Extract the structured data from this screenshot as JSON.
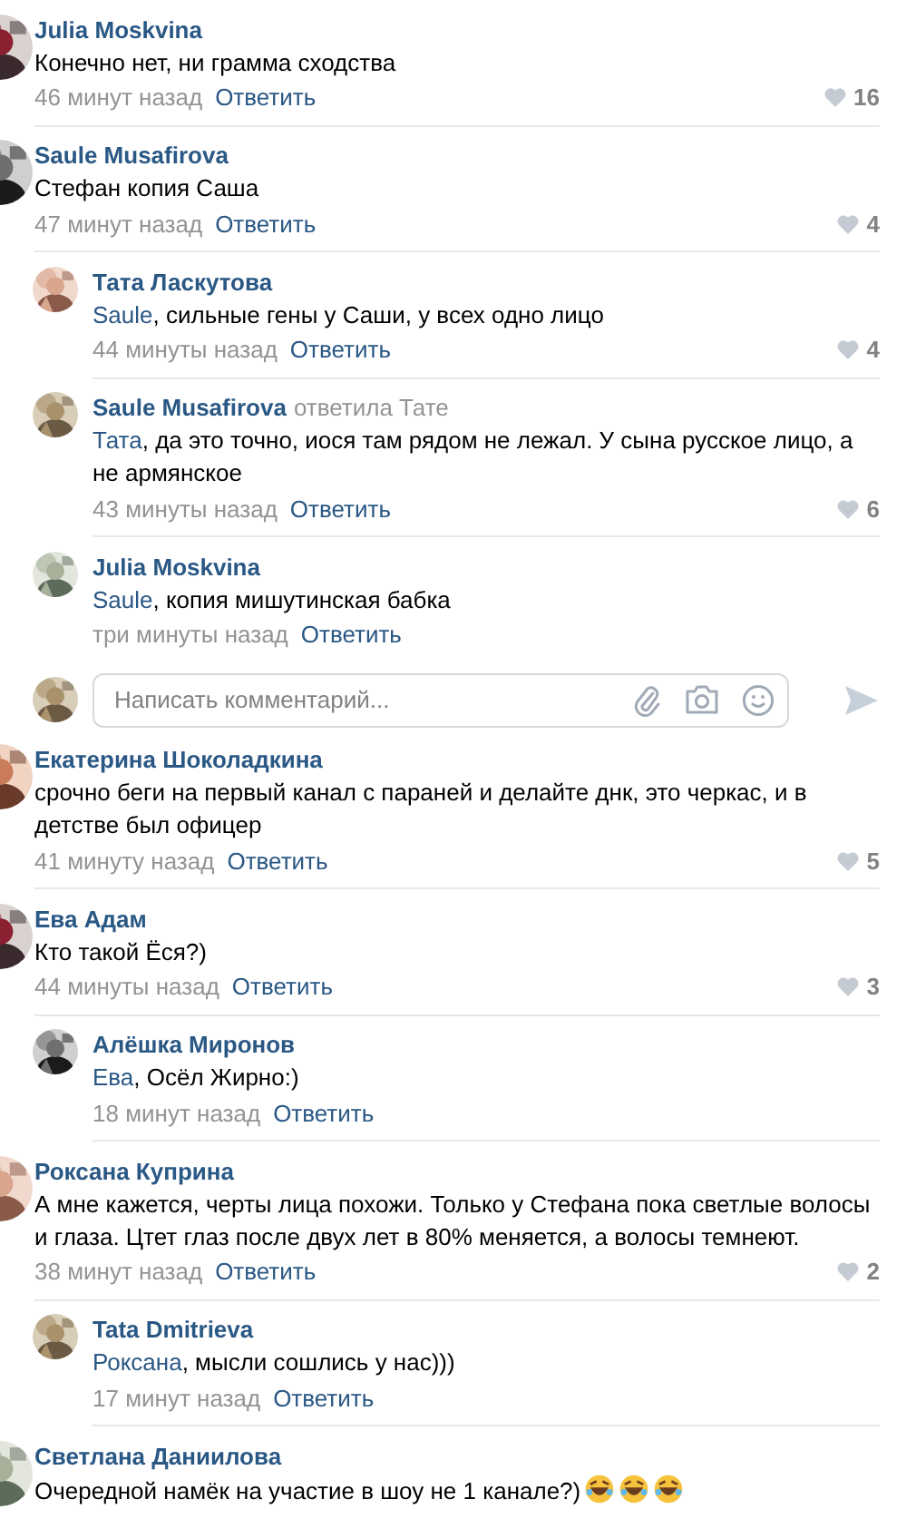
{
  "comments": [
    {
      "author": "Julia Moskvina",
      "text": "Конечно нет, ни грамма сходства",
      "time": "46 минут назад",
      "reply_label": "Ответить",
      "likes": "16"
    },
    {
      "author": "Saule Musafirova",
      "text": "Стефан копия Саша",
      "time": "47 минут назад",
      "reply_label": "Ответить",
      "likes": "4",
      "children": [
        {
          "author": "Тата Ласкутова",
          "mention": "Saule",
          "text": ", сильные гены у Саши, у всех одно лицо",
          "time": "44 минуты назад",
          "reply_label": "Ответить",
          "likes": "4"
        },
        {
          "author": "Saule Musafirova",
          "replied_to": "ответила Тате",
          "mention": "Тата",
          "text": ", да это точно, иося там рядом не лежал. У сына русское лицо, а не армянское",
          "time": "43 минуты назад",
          "reply_label": "Ответить",
          "likes": "6"
        },
        {
          "author": "Julia Moskvina",
          "mention": "Saule",
          "text": ", копия мишутинская бабка",
          "time": "три минуты назад",
          "reply_label": "Ответить"
        }
      ],
      "reply_form": {
        "placeholder": "Написать комментарий..."
      }
    },
    {
      "author": "Екатерина Шоколадкина",
      "text": "срочно беги на первый канал с параней и делайте днк, это черкас, и в детстве был офицер",
      "time": "41 минуту назад",
      "reply_label": "Ответить",
      "likes": "5"
    },
    {
      "author": "Ева Адам",
      "text": "Кто такой Ёся?)",
      "time": "44 минуты назад",
      "reply_label": "Ответить",
      "likes": "3",
      "children": [
        {
          "author": "Алёшка Миронов",
          "mention": "Ева",
          "text": ", Осёл Жирно:)",
          "time": "18 минут назад",
          "reply_label": "Ответить"
        }
      ]
    },
    {
      "author": "Роксана Куприна",
      "text": "А мне кажется, черты лица похожи. Только у Стефана пока светлые волосы и глаза. Цтет глаз после двух лет в 80% меняется, а волосы темнеют.",
      "time": "38 минут назад",
      "reply_label": "Ответить",
      "likes": "2",
      "children": [
        {
          "author": "Tata Dmitrieva",
          "mention": "Роксана",
          "text": ", мысли сошлись у нас)))",
          "time": "17 минут назад",
          "reply_label": "Ответить"
        }
      ]
    },
    {
      "author": "Светлана Даниилова",
      "text": "Очередной намёк на участие в шоу не 1 канале?)",
      "emojis": [
        {
          "kind": "laughing"
        },
        {
          "kind": "laughing"
        },
        {
          "kind": "laughing"
        }
      ]
    }
  ]
}
